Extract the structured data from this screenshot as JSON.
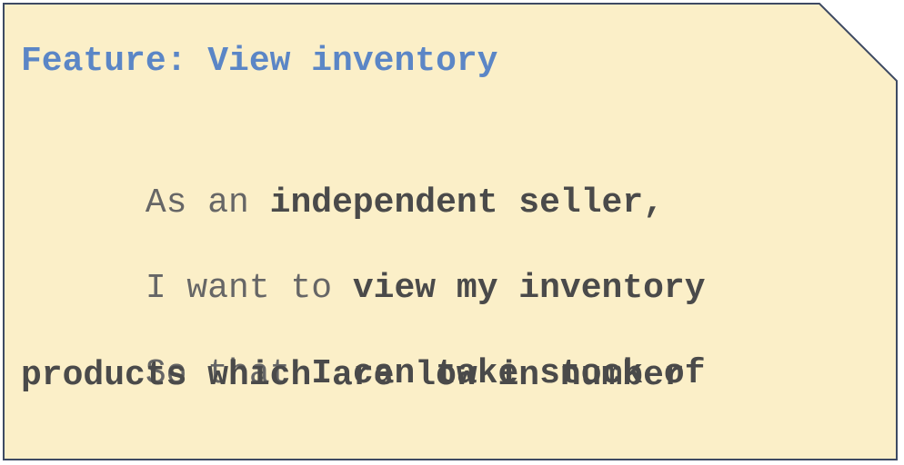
{
  "card": {
    "colors": {
      "background": "#fbefc8",
      "border": "#3e4a63",
      "title": "#5b86c6",
      "text": "#595959"
    }
  },
  "story": {
    "title": "Feature: View inventory",
    "role_prefix": "As an ",
    "role": "independent seller,",
    "want_prefix": "I want to ",
    "want": "view my inventory",
    "benefit_prefix": "So that ",
    "benefit_line1": "I can take stock of",
    "benefit_line2": "products which are low in number"
  }
}
